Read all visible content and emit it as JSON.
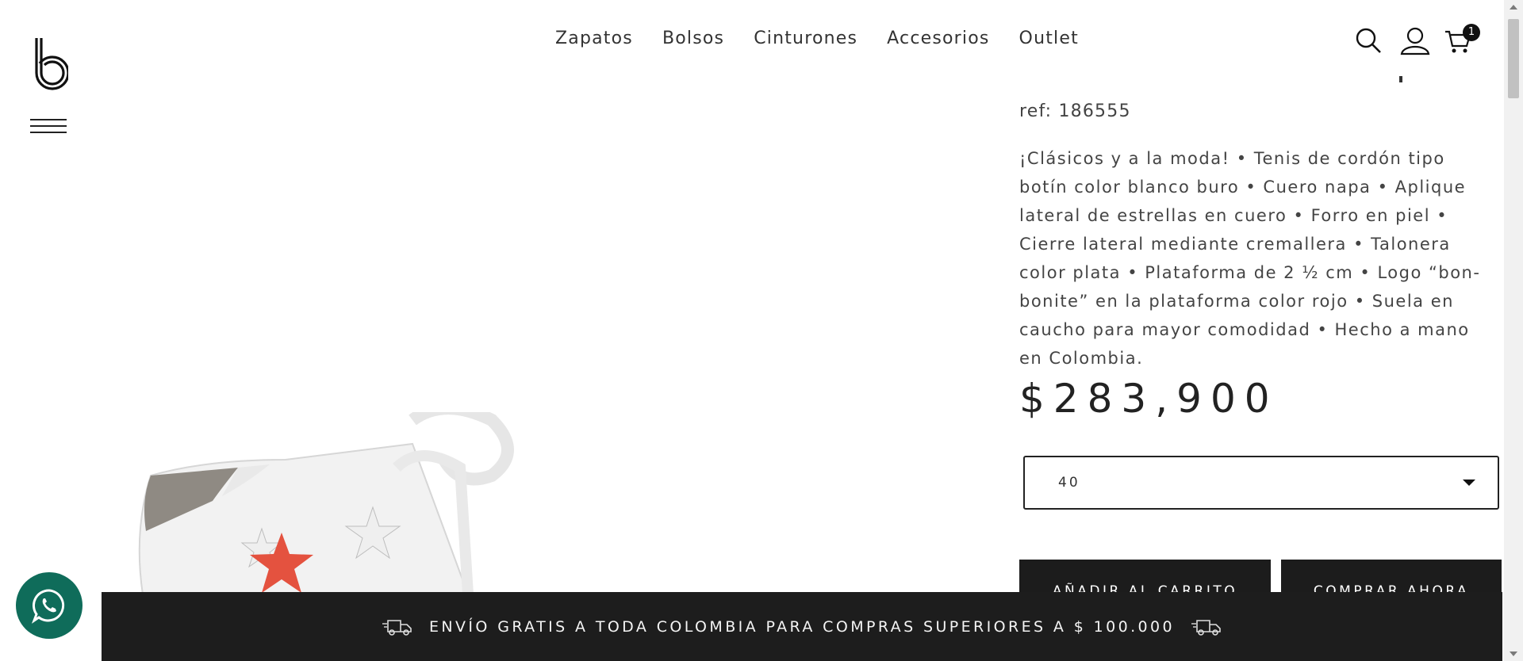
{
  "header": {
    "nav": [
      "Zapatos",
      "Bolsos",
      "Cinturones",
      "Accesorios",
      "Outlet"
    ],
    "cart_count": "1",
    "icons": [
      "search-icon",
      "user-icon",
      "cart-icon"
    ]
  },
  "product": {
    "ref": "ref: 186555",
    "description": "¡Clásicos y a la moda! • Tenis de cordón tipo botín color blanco buro • Cuero napa • Aplique lateral de estrellas en cuero • Forro en piel • Cierre lateral mediante cremallera • Talonera color plata • Plataforma de 2 ½ cm • Logo “bon-bonite” en la plataforma color rojo • Suela en caucho para mayor comodidad • Hecho a mano en Colombia.",
    "price": "$283,900",
    "size_selected": "40",
    "add_to_cart_label": "AÑADIR AL CARRITO",
    "buy_now_label": "COMPRAR AHORA"
  },
  "banner": {
    "text": "ENVÍO GRATIS A TODA COLOMBIA PARA COMPRAS SUPERIORES A $ 100.000"
  },
  "colors": {
    "banner_bg": "#1d1d1d",
    "whatsapp_bg": "#0f6c5a",
    "accent_star": "#e4523f"
  }
}
